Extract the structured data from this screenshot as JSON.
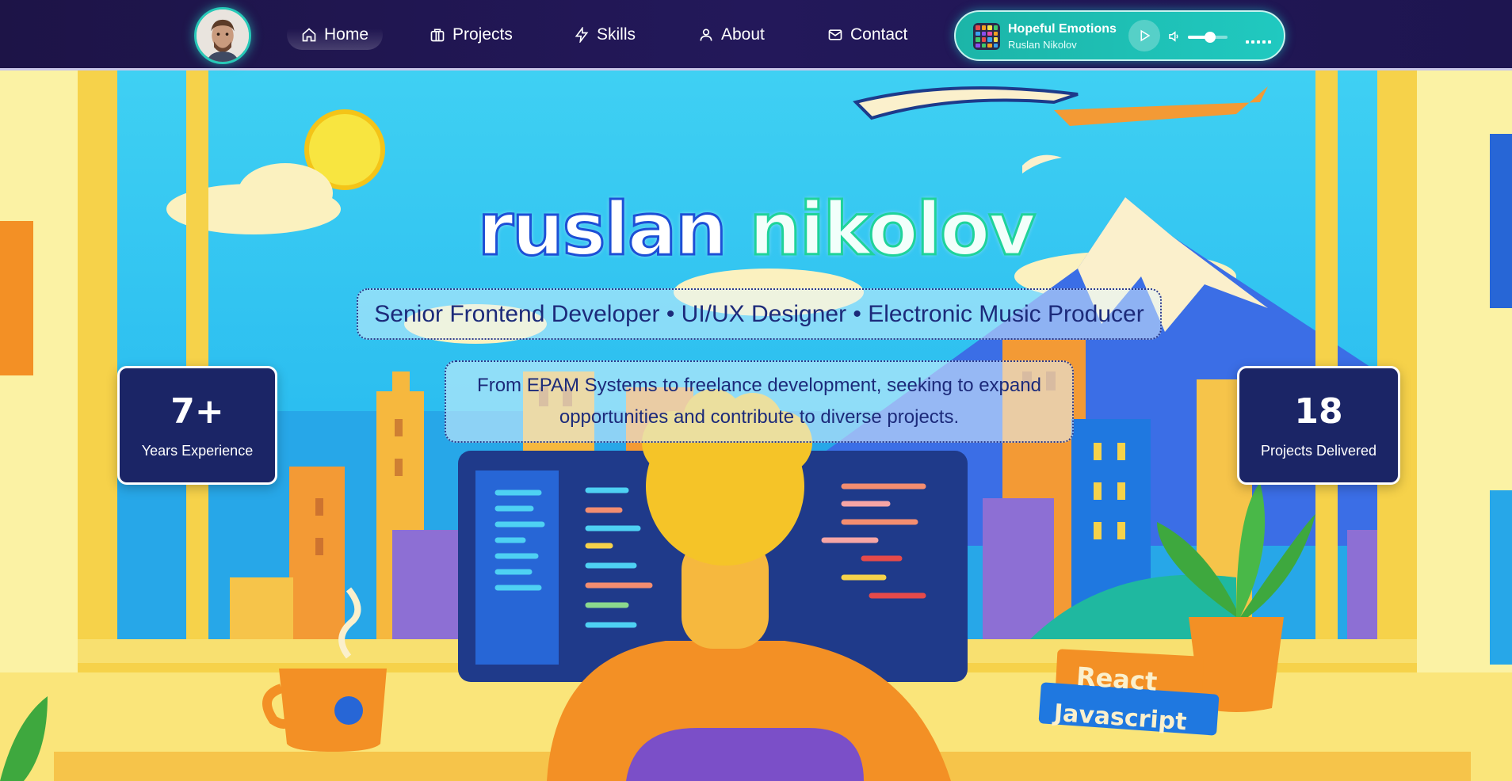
{
  "nav": {
    "items": [
      {
        "label": "Home",
        "icon": "home-icon",
        "active": true
      },
      {
        "label": "Projects",
        "icon": "briefcase-icon",
        "active": false
      },
      {
        "label": "Skills",
        "icon": "lightning-icon",
        "active": false
      },
      {
        "label": "About",
        "icon": "user-icon",
        "active": false
      },
      {
        "label": "Contact",
        "icon": "mail-icon",
        "active": false
      }
    ]
  },
  "player": {
    "title": "Hopeful Emotions",
    "artist": "Ruslan Nikolov",
    "volume": 0.55
  },
  "hero": {
    "name_first": "ruslan",
    "name_last": "nikolov",
    "subtitle": "Senior Frontend Developer • UI/UX Designer • Electronic Music Producer",
    "tagline": "From EPAM Systems to freelance development, seeking to expand opportunities and contribute to diverse projects."
  },
  "stats": [
    {
      "value": "7+",
      "label": "Years Experience"
    },
    {
      "value": "18",
      "label": "Projects Delivered"
    }
  ],
  "illustration": {
    "books": [
      "React",
      "Javascript"
    ]
  },
  "colors": {
    "nav_bg": "#1d1447",
    "accent_teal": "#20c9c0",
    "stat_bg": "#1b2566",
    "text_dark_blue": "#1c2a7a"
  }
}
